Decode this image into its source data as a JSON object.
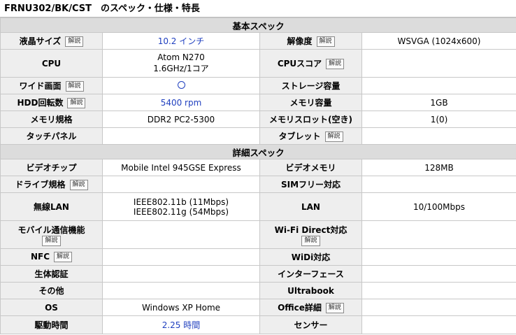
{
  "page_title": "FRNU302/BK/CST　のスペック・仕様・特長",
  "explain_label": "解説",
  "sections": {
    "basic": "基本スペック",
    "detail": "詳細スペック"
  },
  "rows": {
    "lcd_size": {
      "label": "液晶サイズ",
      "value": "10.2 インチ"
    },
    "resolution": {
      "label": "解像度",
      "value": "WSVGA (1024x600)"
    },
    "cpu": {
      "label": "CPU",
      "value_line1": "Atom N270",
      "value_line2": "1.6GHz/1コア"
    },
    "cpu_score": {
      "label": "CPUスコア",
      "value": ""
    },
    "wide_screen": {
      "label": "ワイド画面",
      "value": "○"
    },
    "storage": {
      "label": "ストレージ容量",
      "value": ""
    },
    "hdd_rpm": {
      "label": "HDD回転数",
      "value": "5400 rpm"
    },
    "memory": {
      "label": "メモリ容量",
      "value": "1GB"
    },
    "memory_spec": {
      "label": "メモリ規格",
      "value": "DDR2 PC2-5300"
    },
    "memory_slot": {
      "label": "メモリスロット(空き)",
      "value": "1(0)"
    },
    "touch_panel": {
      "label": "タッチパネル",
      "value": ""
    },
    "tablet": {
      "label": "タブレット",
      "value": ""
    },
    "video_chip": {
      "label": "ビデオチップ",
      "value": "Mobile Intel 945GSE Express"
    },
    "video_memory": {
      "label": "ビデオメモリ",
      "value": "128MB"
    },
    "drive": {
      "label": "ドライブ規格",
      "value": ""
    },
    "sim_free": {
      "label": "SIMフリー対応",
      "value": ""
    },
    "wireless_lan": {
      "label": "無線LAN",
      "value_line1": "IEEE802.11b (11Mbps)",
      "value_line2": "IEEE802.11g (54Mbps)"
    },
    "lan": {
      "label": "LAN",
      "value": "10/100Mbps"
    },
    "mobile_comm": {
      "label": "モバイル通信機能",
      "value": ""
    },
    "wifi_direct": {
      "label": "Wi-Fi Direct対応",
      "value": ""
    },
    "nfc": {
      "label": "NFC",
      "value": ""
    },
    "widi": {
      "label": "WiDi対応",
      "value": ""
    },
    "biometric": {
      "label": "生体認証",
      "value": ""
    },
    "interface": {
      "label": "インターフェース",
      "value": ""
    },
    "other": {
      "label": "その他",
      "value": ""
    },
    "ultrabook": {
      "label": "Ultrabook",
      "value": ""
    },
    "os": {
      "label": "OS",
      "value": "Windows XP Home"
    },
    "office": {
      "label": "Office詳細",
      "value": ""
    },
    "battery": {
      "label": "駆動時間",
      "value": "2.25 時間"
    },
    "sensor": {
      "label": "センサー",
      "value": ""
    }
  }
}
